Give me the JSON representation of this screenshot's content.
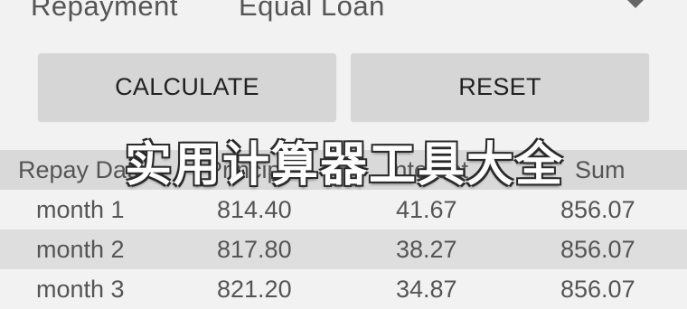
{
  "repayment": {
    "label": "Repayment",
    "value": "Equal Loan",
    "dropdown_icon": "dropdown-arrow-icon"
  },
  "buttons": {
    "calculate_label": "CALCULATE",
    "reset_label": "RESET"
  },
  "table": {
    "headers": [
      "Repay Date",
      "Principal",
      "Interest",
      "Sum"
    ],
    "rows": [
      [
        "month 1",
        "814.40",
        "41.67",
        "856.07"
      ],
      [
        "month 2",
        "817.80",
        "38.27",
        "856.07"
      ],
      [
        "month 3",
        "821.20",
        "34.87",
        "856.07"
      ]
    ]
  },
  "watermark": "实用计算器工具大全",
  "colors": {
    "background": "#f2f2f2",
    "button": "#d6d6d6",
    "header_row": "#d9d9d9",
    "shaded_row": "#dedede",
    "text": "#555555"
  }
}
